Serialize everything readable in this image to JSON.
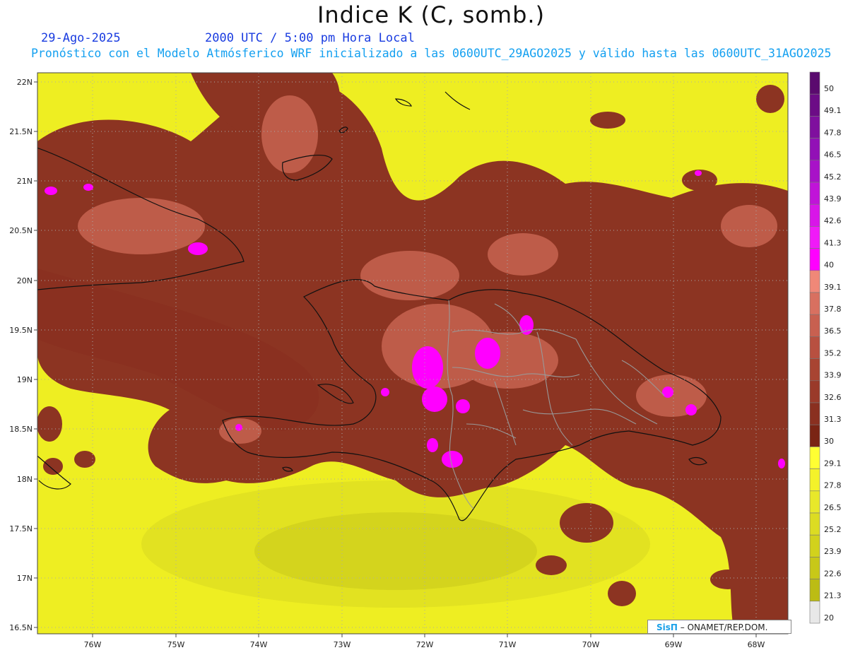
{
  "title": "Indice K (C, somb.)",
  "date": "29-Ago-2025",
  "time": "2000 UTC / 5:00 pm Hora Local",
  "subtitle": "Pronóstico con el Modelo Atmósferico WRF inicializado a las 0600UTC_29AGO2025 y válido hasta las  0600UTC_31AGO2025",
  "lat_labels": [
    "22N",
    "21.5N",
    "21N",
    "20.5N",
    "20N",
    "19.5N",
    "19N",
    "18.5N",
    "18N",
    "17.5N",
    "17N",
    "16.5N"
  ],
  "lon_labels": [
    "76W",
    "75W",
    "74W",
    "73W",
    "72W",
    "71W",
    "70W",
    "69W",
    "68W"
  ],
  "colorbar": {
    "labels": [
      "50",
      "49.1",
      "47.8",
      "46.5",
      "45.2",
      "43.9",
      "42.6",
      "41.3",
      "40",
      "39.1",
      "37.8",
      "36.5",
      "35.2",
      "33.9",
      "32.6",
      "31.3",
      "30",
      "29.1",
      "27.8",
      "26.5",
      "25.2",
      "23.9",
      "22.6",
      "21.3",
      "20"
    ],
    "colors": [
      "#5a0a6e",
      "#6c0c86",
      "#7f0f9e",
      "#9210b6",
      "#a812c8",
      "#c014d8",
      "#d816e8",
      "#f01af8",
      "#ff00ff",
      "#f08878",
      "#d87060",
      "#c86050",
      "#b85040",
      "#a84432",
      "#9a3a2a",
      "#8a3020",
      "#7a2414",
      "#ffff33",
      "#f4f22a",
      "#e8e82a",
      "#dcdc22",
      "#d2d21c",
      "#c8c818",
      "#bcbc14",
      "#e8e8e8"
    ]
  },
  "credit": {
    "brand": "SisΠ",
    "text": " – ONAMET/REP.DOM."
  }
}
